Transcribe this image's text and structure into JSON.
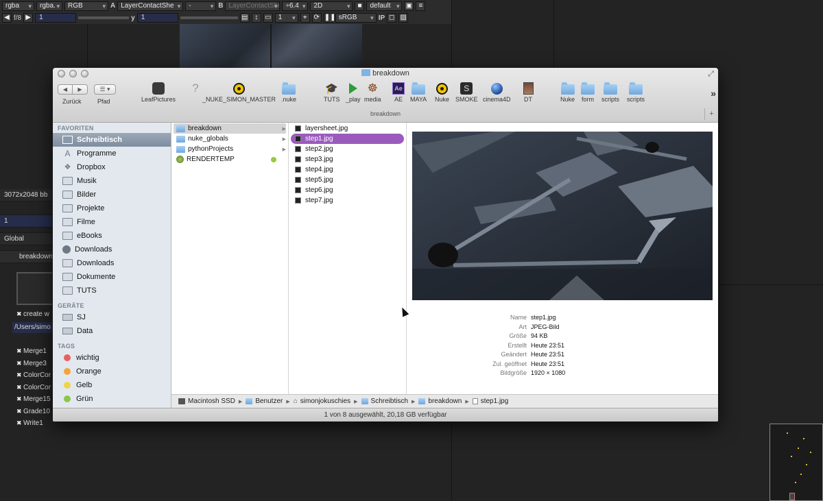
{
  "nuke": {
    "toolbar1": {
      "channels": "rgba",
      "channels_alpha": "rgba.",
      "colorspace": "RGB",
      "input_a_label": "A",
      "input_a": "LayerContactShe",
      "blend": "-",
      "input_b_label": "B",
      "input_b": "LayerContactShe",
      "gain": "÷6.4",
      "view_mode": "2D",
      "lut": "default"
    },
    "toolbar2": {
      "fstop": "f/8",
      "frame": "1",
      "y_label": "y",
      "y_value": "1",
      "frame_display": "1",
      "display_lut": "sRGB",
      "ip_label": "IP"
    },
    "left_panel": {
      "format": "3072x2048 bb",
      "frame_field": "1",
      "scope": "Global",
      "tab": "breakdown",
      "create_label": "create w",
      "path": "/Users/simo"
    },
    "nodes": [
      "Merge1",
      "Merge3",
      "ColorCor",
      "ColorCor",
      "Merge15",
      "Grade10",
      "Write1"
    ]
  },
  "finder": {
    "title": "breakdown",
    "nav": {
      "back": "◀",
      "forward": "▶",
      "back_label": "Zurück",
      "view_label": "Pfad"
    },
    "toolbar_items": [
      {
        "label": "LeafPictures",
        "icon": "leaf-icon"
      },
      {
        "label": "",
        "icon": "question-icon"
      },
      {
        "label": "_NUKE_SIMON_MASTER",
        "icon": "nuke-icon"
      },
      {
        "label": ".nuke",
        "icon": "folder-icon"
      },
      {
        "label": "TUTS",
        "icon": "graduate-icon"
      },
      {
        "label": "_play",
        "icon": "play-icon"
      },
      {
        "label": "media",
        "icon": "wheel-icon"
      },
      {
        "label": "AE",
        "icon": "ae-icon"
      },
      {
        "label": "MAYA",
        "icon": "folder-icon"
      },
      {
        "label": "Nuke",
        "icon": "nuke-icon"
      },
      {
        "label": "SMOKE",
        "icon": "smoke-icon"
      },
      {
        "label": "cinema4D",
        "icon": "cinema4d-icon"
      },
      {
        "label": "DT",
        "icon": "portrait-icon"
      },
      {
        "label": "Nuke",
        "icon": "folder-icon"
      },
      {
        "label": "form",
        "icon": "folder-icon"
      },
      {
        "label": "scripts",
        "icon": "folder-icon"
      },
      {
        "label": "scripts",
        "icon": "folder-icon"
      }
    ],
    "path_title": "breakdown",
    "sidebar": {
      "favorites_header": "FAVORITEN",
      "favorites": [
        {
          "label": "Schreibtisch",
          "icon": "desktop-icon",
          "selected": true
        },
        {
          "label": "Programme",
          "icon": "apps-icon"
        },
        {
          "label": "Dropbox",
          "icon": "dropbox-icon"
        },
        {
          "label": "Musik",
          "icon": "folder-icon"
        },
        {
          "label": "Bilder",
          "icon": "folder-icon"
        },
        {
          "label": "Projekte",
          "icon": "folder-icon"
        },
        {
          "label": "Filme",
          "icon": "folder-icon"
        },
        {
          "label": "eBooks",
          "icon": "folder-icon"
        },
        {
          "label": "Downloads",
          "icon": "download-icon"
        },
        {
          "label": "Downloads",
          "icon": "folder-icon"
        },
        {
          "label": "Dokumente",
          "icon": "folder-icon"
        },
        {
          "label": "TUTS",
          "icon": "folder-icon"
        }
      ],
      "devices_header": "GERÄTE",
      "devices": [
        {
          "label": "SJ",
          "icon": "disk-icon"
        },
        {
          "label": "Data",
          "icon": "disk-icon"
        }
      ],
      "tags_header": "TAGS",
      "tags": [
        {
          "label": "wichtig",
          "color": "#e8605c"
        },
        {
          "label": "Orange",
          "color": "#f5a33b"
        },
        {
          "label": "Gelb",
          "color": "#f1d34a"
        },
        {
          "label": "Grün",
          "color": "#8cc64a"
        }
      ]
    },
    "column1": [
      {
        "label": "breakdown",
        "icon": "folder-icon",
        "selected": true
      },
      {
        "label": "nuke_globals",
        "icon": "folder-icon"
      },
      {
        "label": "pythonProjects",
        "icon": "folder-icon"
      },
      {
        "label": "RENDERTEMP",
        "icon": "disc-icon",
        "tag": "#9acb3c"
      }
    ],
    "column2": [
      {
        "label": "layersheet.jpg"
      },
      {
        "label": "step1.jpg",
        "selected": true
      },
      {
        "label": "step2.jpg"
      },
      {
        "label": "step3.jpg"
      },
      {
        "label": "step4.jpg"
      },
      {
        "label": "step5.jpg"
      },
      {
        "label": "step6.jpg"
      },
      {
        "label": "step7.jpg"
      }
    ],
    "info": [
      {
        "key": "Name",
        "value": "step1.jpg"
      },
      {
        "key": "Art",
        "value": "JPEG-Bild"
      },
      {
        "key": "Größe",
        "value": "94 KB"
      },
      {
        "key": "Erstellt",
        "value": "Heute 23:51"
      },
      {
        "key": "Geändert",
        "value": "Heute 23:51"
      },
      {
        "key": "Zul. geöffnet",
        "value": "Heute 23:51"
      },
      {
        "key": "Bildgröße",
        "value": "1920 × 1080"
      }
    ],
    "pathbar": [
      {
        "label": "Macintosh SSD",
        "icon": "disk-icon"
      },
      {
        "label": "Benutzer",
        "icon": "folder-icon"
      },
      {
        "label": "simonjokuschies",
        "icon": "home-icon"
      },
      {
        "label": "Schreibtisch",
        "icon": "desktop-icon"
      },
      {
        "label": "breakdown",
        "icon": "folder-icon"
      },
      {
        "label": "step1.jpg",
        "icon": "file-icon"
      }
    ],
    "status": "1 von 8 ausgewählt, 20,18 GB verfügbar"
  }
}
